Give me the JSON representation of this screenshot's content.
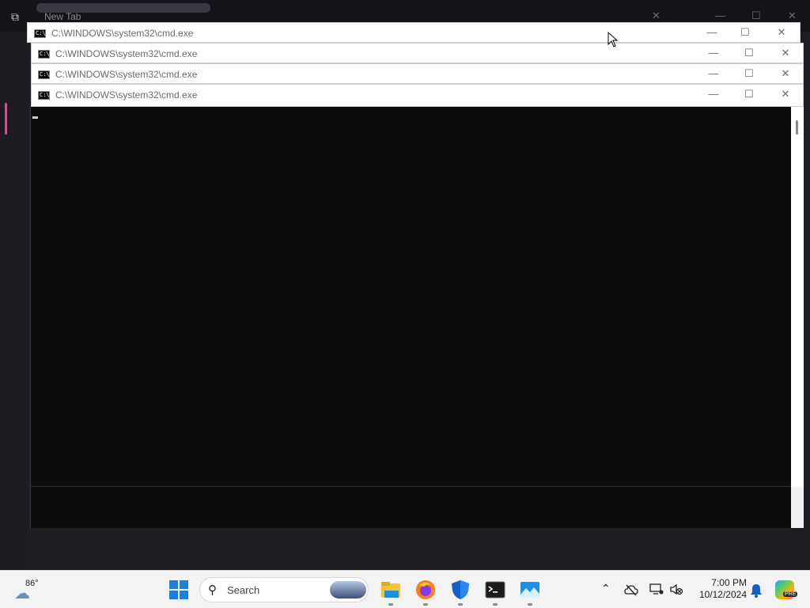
{
  "background_browser": {
    "tab_label": "New Tab"
  },
  "cmd_windows": [
    {
      "title": "C:\\WINDOWS\\system32\\cmd.exe"
    },
    {
      "title": "C:\\WINDOWS\\system32\\cmd.exe"
    },
    {
      "title": "C:\\WINDOWS\\system32\\cmd.exe"
    },
    {
      "title": "C:\\WINDOWS\\system32\\cmd.exe"
    }
  ],
  "window_controls": {
    "minimize": "—",
    "maximize": "☐",
    "close": "✕"
  },
  "taskbar": {
    "weather_temp": "86°",
    "search_placeholder": "Search",
    "apps": [
      "file-explorer-icon",
      "firefox-icon",
      "windows-security-icon",
      "terminal-icon",
      "photos-icon"
    ],
    "clock_time": "7:00 PM",
    "clock_date": "10/12/2024",
    "copilot_badge": "PRE"
  },
  "colors": {
    "console_bg": "#0c0c0c",
    "taskbar_bg": "#f3f3f3",
    "start_blue": "#1a7fe0"
  }
}
